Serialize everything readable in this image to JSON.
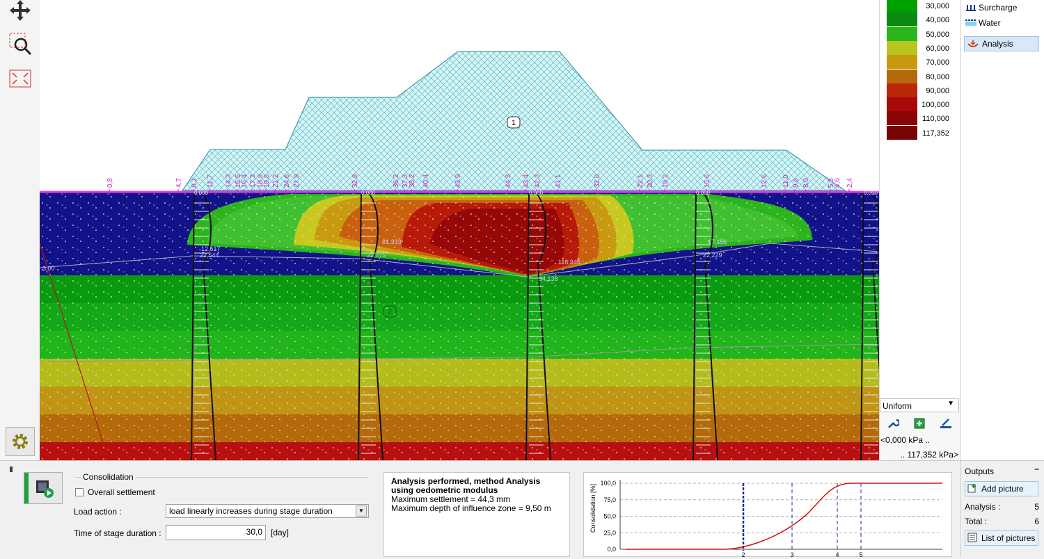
{
  "legend": {
    "values": [
      "30,000",
      "40,000",
      "50,000",
      "60,000",
      "70,000",
      "80,000",
      "90,000",
      "100,000",
      "110,000",
      "117,352"
    ],
    "colors": [
      "#00a000",
      "#0a8a10",
      "#2cb41c",
      "#b8c420",
      "#c89a10",
      "#b46a08",
      "#b82808",
      "#a80808",
      "#8a0606",
      "#760404"
    ]
  },
  "right_panel": {
    "surcharge": "Surcharge",
    "water": "Water",
    "analysis": "Analysis"
  },
  "colorbar": {
    "mode": "Uniform",
    "min": "<0,000 kPa ..",
    "max": ".. 117,352 kPa>"
  },
  "outputs": {
    "title": "Outputs",
    "add_picture": "Add picture",
    "analysis_label": "Analysis :",
    "analysis_count": "5",
    "total_label": "Total :",
    "total_count": "6",
    "list_pictures": "List of pictures"
  },
  "consolidation": {
    "group_title": "Consolidation",
    "overall_settlement": "Overall settlement",
    "overall_settlement_checked": false,
    "load_action_label": "Load action :",
    "load_action_value": "load linearly increases during stage duration",
    "time_label": "Time of stage duration :",
    "time_value": "30,0",
    "time_unit": "[day]"
  },
  "results": {
    "headline": "Analysis performed, method Analysis using oedometric modulus",
    "line1": "Maximum settlement = 44,3 mm",
    "line2": "Maximum depth of influence zone = 9,50 m"
  },
  "graph": {
    "ylabel": "Consolidation [%]",
    "yticks": [
      "100,0",
      "75,0",
      "50,0",
      "25,0",
      "0,0"
    ],
    "xmarks": [
      "2",
      "3",
      "4",
      "5"
    ],
    "line_color": "#d01010"
  },
  "canvas": {
    "surface_labels": [
      "0,8",
      "4,7",
      "8,1",
      "11,7",
      "14,3",
      "15,5",
      "16,4",
      "17,3",
      "18,9",
      "19,5",
      "21,2",
      "24,6",
      "27,9",
      "32,9",
      "36,2",
      "37,3",
      "38,2",
      "40,4",
      "43,9",
      "44,3",
      "43,4",
      "42,3",
      "41,1",
      "32,0",
      "22,1",
      "20,3",
      "19,2",
      "15,6",
      "12,6",
      "11,0",
      "9,6",
      "8,0",
      "5,3",
      "4,6",
      "2,4"
    ],
    "embankment_tag": "1",
    "soil_tag": "2",
    "borehole_values": [
      "12,617",
      "22,544",
      "81,333",
      "22,775",
      "116,945",
      "34,138",
      "17,152",
      "22,229",
      "3,00"
    ],
    "borehole_tops": [
      "0,000",
      "0,000",
      "0,000",
      "0,000",
      "0,000"
    ]
  },
  "dividers": [
    "#d0d0d0"
  ]
}
